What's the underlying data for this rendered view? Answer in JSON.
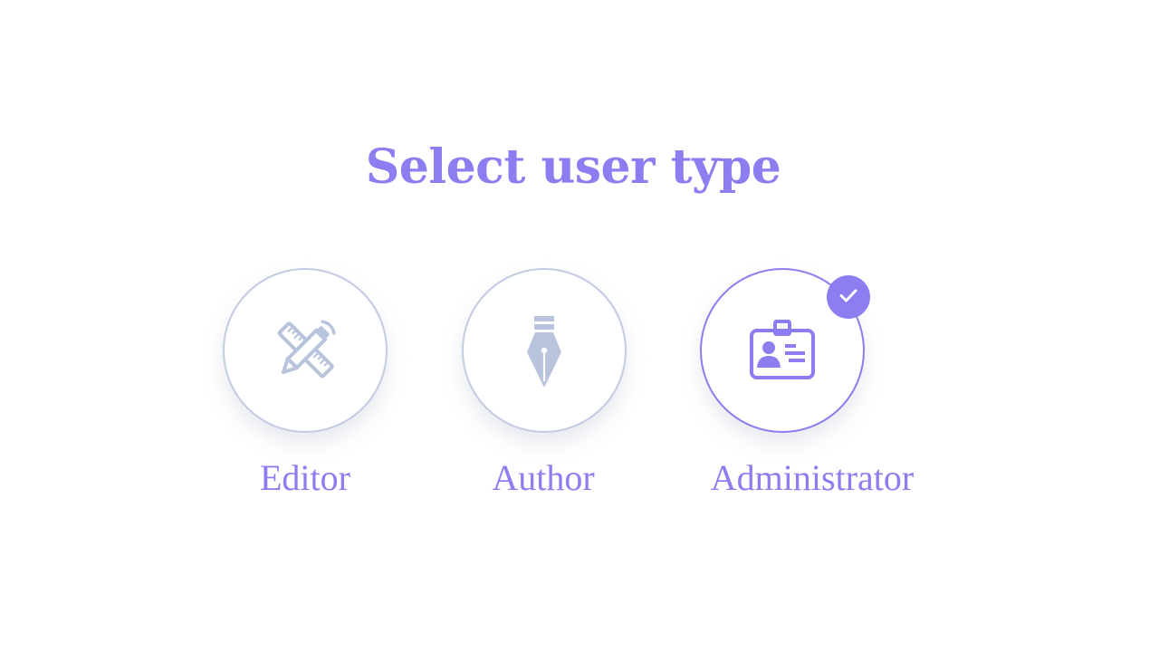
{
  "heading": "Select user type",
  "colors": {
    "accent": "#8c7ef0",
    "inactive_icon": "#b8c3dc",
    "inactive_border": "#c3cbe2"
  },
  "options": [
    {
      "label": "Editor",
      "icon": "ruler-pencil-icon",
      "selected": false
    },
    {
      "label": "Author",
      "icon": "fountain-pen-icon",
      "selected": false
    },
    {
      "label": "Administrator",
      "icon": "id-badge-icon",
      "selected": true,
      "check_icon": "checkmark-icon"
    }
  ]
}
